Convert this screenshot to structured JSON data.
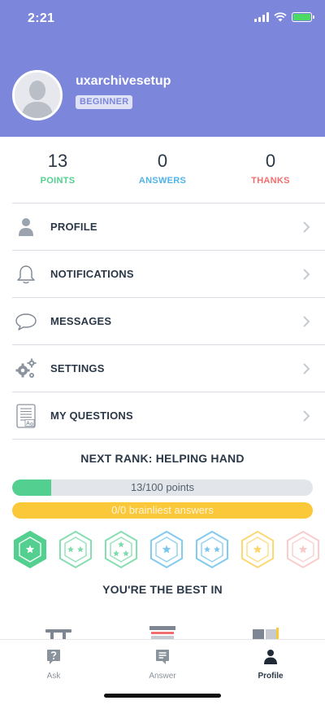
{
  "status_bar": {
    "time": "2:21"
  },
  "profile": {
    "username": "uxarchivesetup",
    "rank": "BEGINNER"
  },
  "stats": [
    {
      "value": "13",
      "label": "POINTS",
      "color": "#53cf8f"
    },
    {
      "value": "0",
      "label": "ANSWERS",
      "color": "#4fb3e8"
    },
    {
      "value": "0",
      "label": "THANKS",
      "color": "#f26d6d"
    }
  ],
  "menu": [
    {
      "label": "PROFILE",
      "icon": "person-icon"
    },
    {
      "label": "NOTIFICATIONS",
      "icon": "bell-icon"
    },
    {
      "label": "MESSAGES",
      "icon": "speech-bubble-icon"
    },
    {
      "label": "SETTINGS",
      "icon": "gears-icon"
    },
    {
      "label": "MY QUESTIONS",
      "icon": "document-icon"
    }
  ],
  "next_rank": {
    "title": "NEXT RANK: HELPING HAND",
    "points_text": "13/100 points",
    "points_progress": 0.13,
    "brainliest_text": "0/0 brainliest answers",
    "brainliest_progress": 0
  },
  "badges": [
    {
      "color": "#53cf8f",
      "stars": 1,
      "earned": true
    },
    {
      "color": "#53cf8f",
      "stars": 2,
      "earned": false
    },
    {
      "color": "#53cf8f",
      "stars": 3,
      "earned": false
    },
    {
      "color": "#4fb3e8",
      "stars": 1,
      "earned": false
    },
    {
      "color": "#4fb3e8",
      "stars": 2,
      "earned": false
    },
    {
      "color": "#fbc83a",
      "stars": 1,
      "earned": false
    },
    {
      "color": "#f26d6d",
      "stars": 1,
      "earned": false
    }
  ],
  "best_in": {
    "title": "YOU'RE THE BEST IN"
  },
  "tabbar": [
    {
      "label": "Ask",
      "icon": "ask-question-icon",
      "active": false
    },
    {
      "label": "Answer",
      "icon": "answer-icon",
      "active": false
    },
    {
      "label": "Profile",
      "icon": "profile-icon",
      "active": true
    }
  ],
  "colors": {
    "header": "#7c86db",
    "text_dark": "#2b3847",
    "divider": "#d9dce2"
  }
}
